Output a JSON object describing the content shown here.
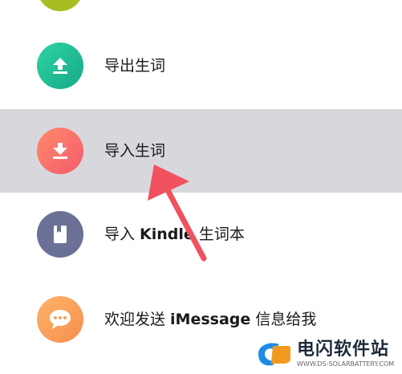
{
  "menu": {
    "items": [
      {
        "label": "导出生词",
        "icon": "upload-icon",
        "color_from": "#2fd4a1",
        "color_to": "#17a88a"
      },
      {
        "label": "导入生词",
        "icon": "download-icon",
        "color_from": "#ff8a6a",
        "color_to": "#f45b6c",
        "highlighted": true
      },
      {
        "label_prefix": "导入 ",
        "label_bold": "Kindle",
        "label_suffix": " 生词本",
        "icon": "book-icon",
        "color": "#6b7196"
      },
      {
        "label_prefix": "欢迎发送 ",
        "label_bold": "iMessage",
        "label_suffix": " 信息给我",
        "icon": "chat-bubble-icon",
        "color_from": "#ffb36a",
        "color_to": "#f58f4e"
      }
    ]
  },
  "annotation": {
    "arrow_color": "#f0525e"
  },
  "watermark": {
    "title": "电闪软件站",
    "url": "WWW.DS-SOLARBATTERY.COM"
  }
}
